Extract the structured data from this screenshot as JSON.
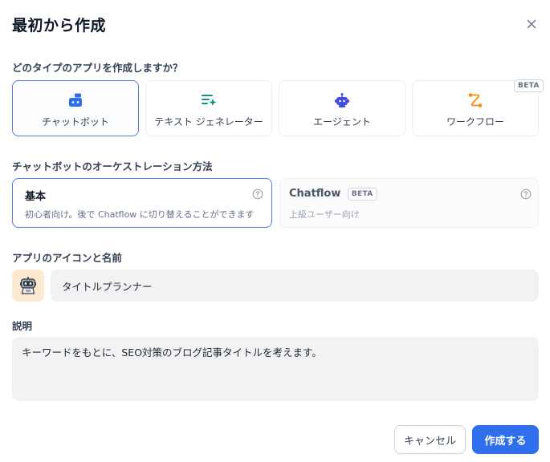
{
  "dialog": {
    "title": "最初から作成"
  },
  "app_type": {
    "label": "どのタイプのアプリを作成しますか？",
    "options": [
      {
        "label": "チャットボット",
        "icon": "chatbot-icon",
        "color": "#2f6fed",
        "selected": true
      },
      {
        "label": "テキスト ジェネレーター",
        "icon": "text-generator-icon",
        "color": "#0e9384",
        "selected": false
      },
      {
        "label": "エージェント",
        "icon": "agent-icon",
        "color": "#444ce7",
        "selected": false
      },
      {
        "label": "ワークフロー",
        "icon": "workflow-icon",
        "color": "#f79009",
        "selected": false,
        "badge": "BETA"
      }
    ]
  },
  "orchestration": {
    "label": "チャットボットのオーケストレーション方法",
    "options": [
      {
        "title": "基本",
        "description": "初心者向け。後で Chatflow に切り替えることができます",
        "selected": true
      },
      {
        "title": "Chatflow",
        "badge": "BETA",
        "description": "上級ユーザー向け",
        "selected": false
      }
    ]
  },
  "icon_name": {
    "label": "アプリのアイコンと名前",
    "avatar": "robot-avatar-icon",
    "name_value": "タイトルプランナー"
  },
  "description": {
    "label": "説明",
    "value": "キーワードをもとに、SEO対策のブログ記事タイトルを考えます。"
  },
  "buttons": {
    "cancel": "キャンセル",
    "create": "作成する"
  },
  "colors": {
    "accent": "#2f6fed",
    "selected_border": "#4f7ee8",
    "input_bg": "#f2f2f3"
  }
}
